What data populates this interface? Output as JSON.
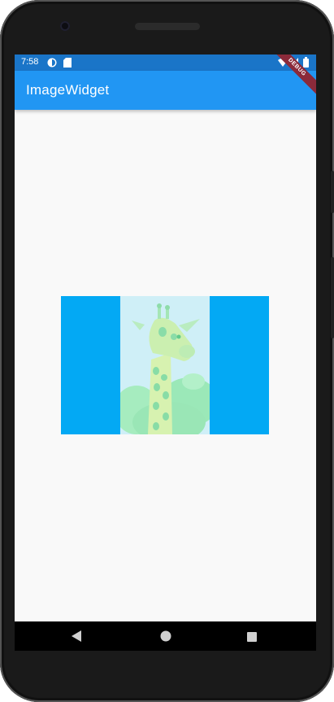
{
  "status_bar": {
    "time": "7:58",
    "icons": [
      "sync-icon",
      "sd-card-icon",
      "wifi-icon",
      "signal-icon",
      "battery-icon"
    ]
  },
  "app_bar": {
    "title": "ImageWidget"
  },
  "debug_banner": {
    "label": "DEBUG"
  },
  "image_widget": {
    "subject": "giraffe-image",
    "colors": {
      "container": "#03a9f4",
      "image_tint": "#cfeff7"
    }
  },
  "navigation_bar": {
    "buttons": [
      "back-icon",
      "home-icon",
      "recents-icon"
    ]
  },
  "colors": {
    "status_bar": "#1a75c8",
    "app_bar": "#2196f3",
    "background": "#f9f9f9"
  }
}
